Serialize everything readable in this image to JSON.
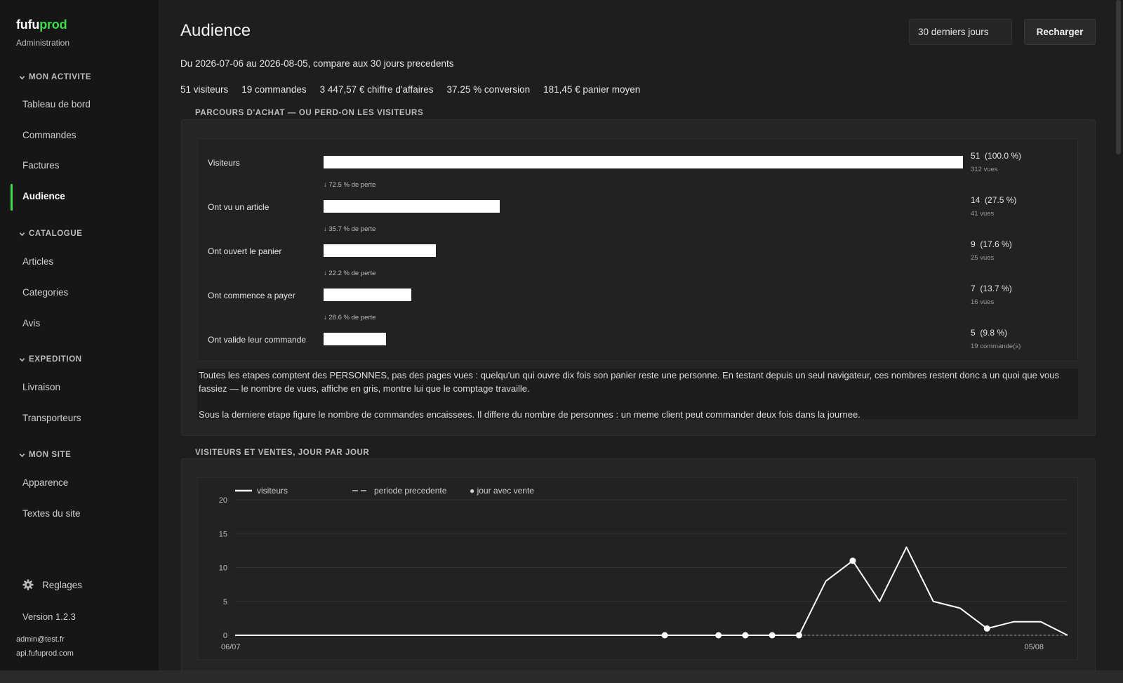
{
  "brand": {
    "part1": "fufu",
    "part2": "prod",
    "subtitle": "Administration"
  },
  "sidebar": {
    "sections": [
      {
        "title": "MON ACTIVITE",
        "items": [
          "Tableau de bord",
          "Commandes",
          "Factures",
          "Audience"
        ]
      },
      {
        "title": "CATALOGUE",
        "items": [
          "Articles",
          "Categories",
          "Avis"
        ]
      },
      {
        "title": "EXPEDITION",
        "items": [
          "Livraison",
          "Transporteurs"
        ]
      },
      {
        "title": "MON SITE",
        "items": [
          "Apparence",
          "Textes du site"
        ]
      }
    ],
    "active_item": "Audience",
    "settings": "Reglages",
    "version": "Version 1.2.3",
    "user_email": "admin@test.fr",
    "api_host": "api.fufuprod.com"
  },
  "header": {
    "title": "Audience",
    "range_select": "30 derniers jours",
    "reload": "Recharger"
  },
  "period": "Du 2026-07-06 au 2026-08-05, compare aux 30 jours precedents",
  "kpis": [
    "51 visiteurs",
    "19 commandes",
    "3 447,57 € chiffre d'affaires",
    "37.25 % conversion",
    "181,45 € panier moyen"
  ],
  "funnel": {
    "title": "PARCOURS D'ACHAT — OU PERD-ON LES VISITEURS",
    "steps": [
      {
        "label": "Visiteurs",
        "count": "51",
        "pct": "(100.0 %)",
        "sub": "312 vues",
        "share": 1.0
      },
      {
        "label": "Ont vu un article",
        "count": "14",
        "pct": "(27.5 %)",
        "sub": "41 vues",
        "share": 0.275
      },
      {
        "label": "Ont ouvert le panier",
        "count": "9",
        "pct": "(17.6 %)",
        "sub": "25 vues",
        "share": 0.176
      },
      {
        "label": "Ont commence a payer",
        "count": "7",
        "pct": "(13.7 %)",
        "sub": "16 vues",
        "share": 0.137
      },
      {
        "label": "Ont valide leur commande",
        "count": "5",
        "pct": "(9.8 %)",
        "sub": "19 commande(s)",
        "share": 0.098
      }
    ],
    "losses": [
      "↓ 72.5 % de perte",
      "↓ 35.7 % de perte",
      "↓ 22.2 % de perte",
      "↓ 28.6 % de perte"
    ],
    "note1": "Toutes les etapes comptent des PERSONNES, pas des pages vues : quelqu'un qui ouvre dix fois son panier reste une personne. En testant depuis un seul navigateur, ces nombres restent donc a un quoi que vous fassiez — le nombre de vues, affiche en gris, montre lui que le comptage travaille.",
    "note2": "Sous la derniere etape figure le nombre de commandes encaissees. Il differe du nombre de personnes : un meme client peut commander deux fois dans la journee."
  },
  "daily": {
    "title": "VISITEURS ET VENTES, JOUR PAR JOUR",
    "legend": {
      "visitors": "visiteurs",
      "previous": "periode precedente",
      "sale_day": "● jour avec vente"
    }
  },
  "chart_data": {
    "type": "line",
    "x_start_label": "06/07",
    "x_end_label": "05/08",
    "yticks": [
      0,
      5,
      10,
      15,
      20
    ],
    "ylim": [
      0,
      20
    ],
    "series": [
      {
        "name": "visiteurs",
        "values": [
          0,
          0,
          0,
          0,
          0,
          0,
          0,
          0,
          0,
          0,
          0,
          0,
          0,
          0,
          0,
          0,
          0,
          0,
          0,
          0,
          0,
          0,
          8,
          11,
          5,
          13,
          5,
          4,
          1,
          2,
          2,
          0
        ]
      },
      {
        "name": "periode precedente",
        "values": [
          0,
          0,
          0,
          0,
          0,
          0,
          0,
          0,
          0,
          0,
          0,
          0,
          0,
          0,
          0,
          0,
          0,
          0,
          0,
          0,
          0,
          0,
          0,
          0,
          0,
          0,
          0,
          0,
          0,
          0,
          0,
          0
        ]
      }
    ],
    "sale_days": [
      16,
      18,
      19,
      20,
      21,
      23,
      28
    ]
  },
  "colors": {
    "accent": "#3ddc4a",
    "bg": "#1e1e1e",
    "sidebar": "#161616",
    "card": "#252525"
  }
}
